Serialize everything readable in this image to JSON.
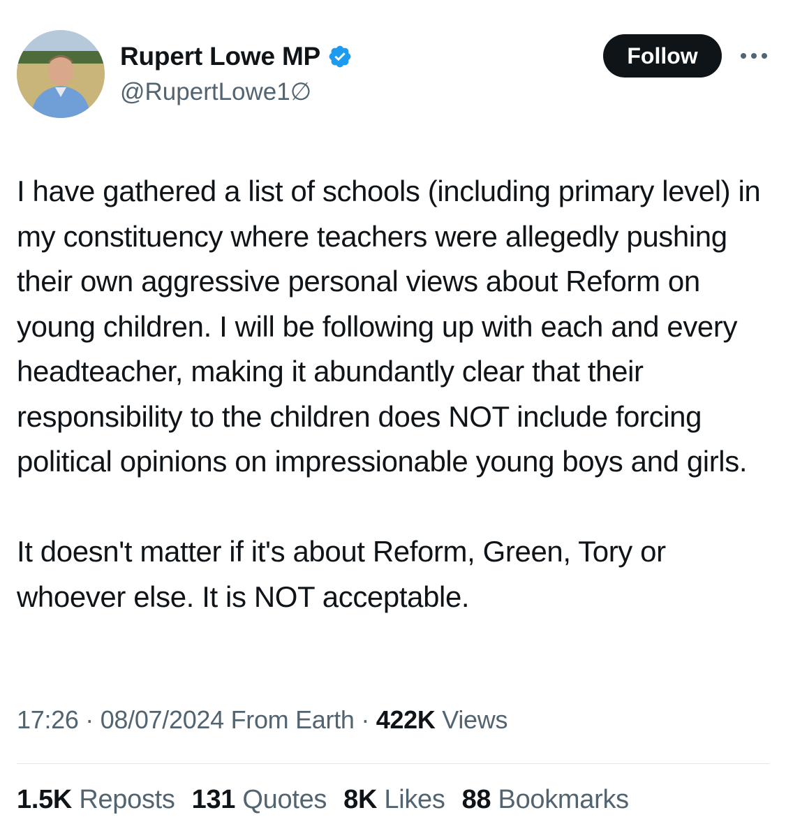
{
  "author": {
    "display_name": "Rupert Lowe MP",
    "handle": "@RupertLowe1∅",
    "verified_icon": "verified-badge-icon",
    "avatar_icon": "profile-photo"
  },
  "actions": {
    "follow_label": "Follow",
    "more_icon": "more-options-icon"
  },
  "post": {
    "paragraphs": [
      "I have gathered a list of schools (including primary level) in my constituency where teachers were allegedly pushing their own aggressive personal views about Reform on young children. I will be following up with each and every headteacher, making it abundantly clear that their responsibility to the children does NOT include forcing political opinions on impressionable young boys and girls.",
      "It doesn't matter if it's about Reform, Green, Tory or whoever else. It is NOT acceptable."
    ]
  },
  "meta": {
    "time": "17:26",
    "date": "08/07/2024",
    "location": "From Earth",
    "separator": " · ",
    "views_count": "422K",
    "views_label": " Views"
  },
  "stats": {
    "reposts": {
      "count": "1.5K",
      "label": " Reposts"
    },
    "quotes": {
      "count": "131",
      "label": " Quotes"
    },
    "likes": {
      "count": "8K",
      "label": " Likes"
    },
    "bookmarks": {
      "count": "88",
      "label": " Bookmarks"
    }
  },
  "colors": {
    "text_primary": "#0f1419",
    "text_secondary": "#536471",
    "verified_blue": "#1d9bf0",
    "divider": "#e1e6ea",
    "button_bg": "#0f1419"
  }
}
